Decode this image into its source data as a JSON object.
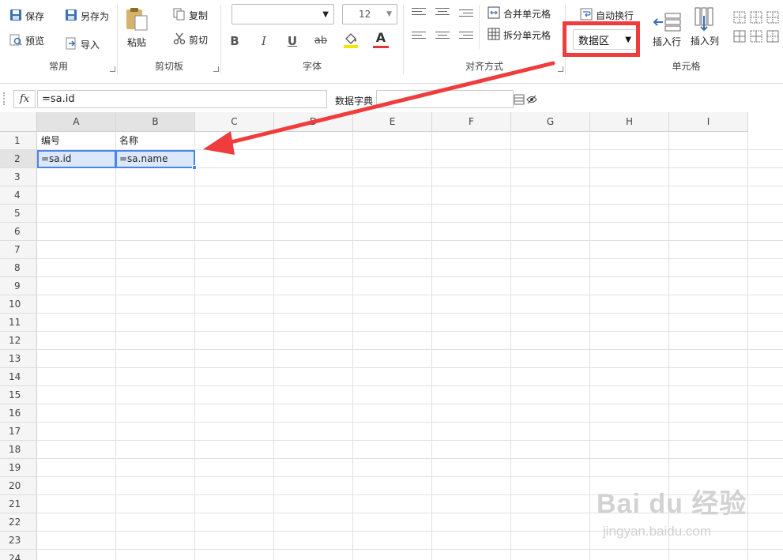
{
  "ribbon": {
    "common": {
      "save": "保存",
      "save_as": "另存为",
      "preview": "预览",
      "import": "导入",
      "label": "常用"
    },
    "clipboard": {
      "paste": "粘贴",
      "copy": "复制",
      "cut": "剪切",
      "label": "剪切板"
    },
    "font": {
      "family_value": "",
      "size_value": "12",
      "bold": "B",
      "italic": "I",
      "underline": "U",
      "strike": "ab",
      "font_color": "A",
      "label": "字体"
    },
    "align": {
      "merge": "合并单元格",
      "split": "拆分单元格",
      "label": "对齐方式"
    },
    "cell": {
      "wrap": "自动换行",
      "region_value": "数据区",
      "insert_row": "插入行",
      "insert_col": "插入列",
      "label": "单元格"
    }
  },
  "formula_bar": {
    "fx": "fx",
    "value": "=sa.id",
    "dict_label": "数据字典"
  },
  "sheet": {
    "columns": [
      "A",
      "B",
      "C",
      "D",
      "E",
      "F",
      "G",
      "H",
      "I"
    ],
    "rows": [
      "1",
      "2",
      "3",
      "4",
      "5",
      "6",
      "7",
      "8",
      "9",
      "10",
      "11",
      "12",
      "13",
      "14",
      "15",
      "16",
      "17",
      "18",
      "19",
      "20",
      "21",
      "22",
      "23",
      "24"
    ],
    "cells": {
      "A1": "编号",
      "B1": "名称",
      "A2": "=sa.id",
      "B2": "=sa.name"
    }
  },
  "watermark": {
    "brand": "Bai du 经验",
    "url": "jingyan.baidu.com"
  },
  "colors": {
    "highlight_red": "#f03c3c",
    "selection_blue": "#4a86e8",
    "selection_fill": "#dbe8fb"
  }
}
